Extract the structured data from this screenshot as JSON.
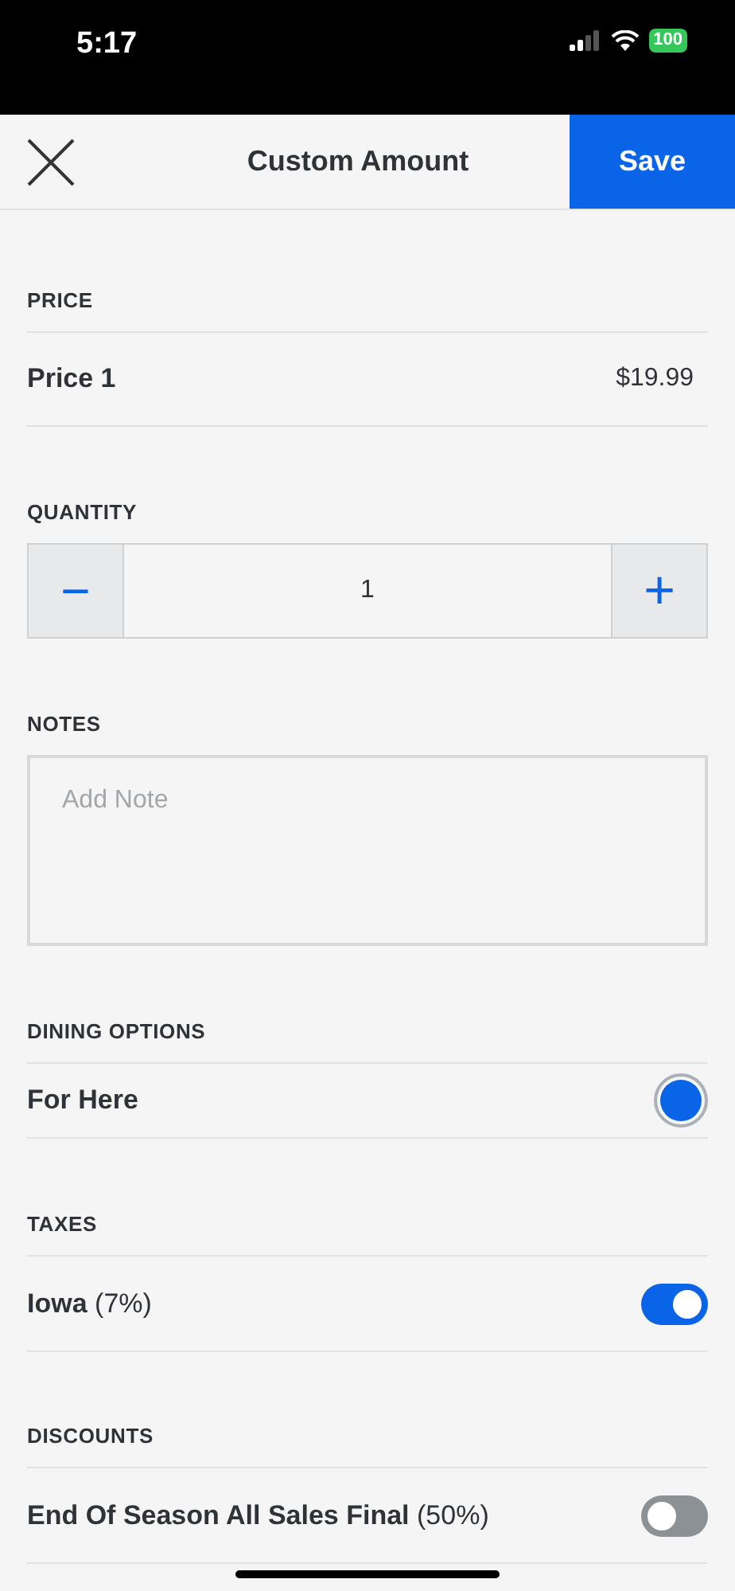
{
  "status_bar": {
    "time": "5:17",
    "battery": "100"
  },
  "header": {
    "title": "Custom Amount",
    "save": "Save"
  },
  "price": {
    "label": "PRICE",
    "name": "Price 1",
    "value": "$19.99"
  },
  "quantity": {
    "label": "QUANTITY",
    "minus": "−",
    "value": "1",
    "plus": "+"
  },
  "notes": {
    "label": "NOTES",
    "placeholder": "Add Note"
  },
  "dining_options": {
    "label": "DINING OPTIONS",
    "items": [
      {
        "name": "For Here",
        "selected": true
      }
    ]
  },
  "taxes": {
    "label": "TAXES",
    "items": [
      {
        "name": "Iowa",
        "rate": "(7%)",
        "on": true
      }
    ]
  },
  "discounts": {
    "label": "DISCOUNTS",
    "items": [
      {
        "name": "End Of Season All Sales Final",
        "rate": "(50%)",
        "on": false
      }
    ]
  }
}
